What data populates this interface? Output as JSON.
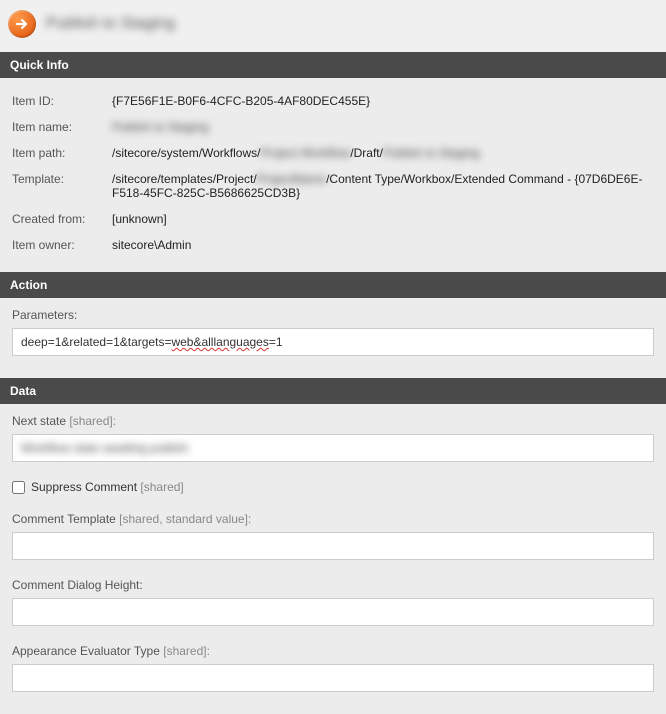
{
  "header": {
    "title": "Publish to Staging"
  },
  "sections": {
    "quick_info": "Quick Info",
    "action": "Action",
    "data": "Data"
  },
  "quick_info": {
    "labels": {
      "item_id": "Item ID:",
      "item_name": "Item name:",
      "item_path": "Item path:",
      "template": "Template:",
      "created_from": "Created from:",
      "item_owner": "Item owner:"
    },
    "values": {
      "item_id": "{F7E56F1E-B0F6-4CFC-B205-4AF80DEC455E}",
      "item_name": "Publish to Staging",
      "item_path_prefix": "/sitecore/system/Workflows/",
      "item_path_mid": "Project Workflow",
      "item_path_draft": "/Draft/",
      "item_path_end": "Publish to Staging",
      "template_prefix": "/sitecore/templates/Project/",
      "template_mid": "ProjectName",
      "template_suffix": "/Content Type/Workbox/Extended Command - {07D6DE6E-F518-45FC-825C-B5686625CD3B}",
      "created_from": "[unknown]",
      "item_owner": "sitecore\\Admin"
    }
  },
  "action": {
    "parameters_label": "Parameters:",
    "parameters_value_pre": "deep=1&related=1&targets=",
    "parameters_value_wavy": "web&alllanguages",
    "parameters_value_post": "=1"
  },
  "data": {
    "next_state_label": "Next state",
    "next_state_hint": "[shared]:",
    "next_state_value": "Workflow state awaiting publish",
    "suppress_label": "Suppress Comment",
    "suppress_hint": "[shared]",
    "suppress_checked": false,
    "comment_template_label": "Comment Template",
    "comment_template_hint": "[shared, standard value]:",
    "comment_template_value": "",
    "comment_dialog_label": "Comment Dialog Height:",
    "comment_dialog_value": "",
    "appearance_label": "Appearance Evaluator Type",
    "appearance_hint": "[shared]:",
    "appearance_value": ""
  }
}
